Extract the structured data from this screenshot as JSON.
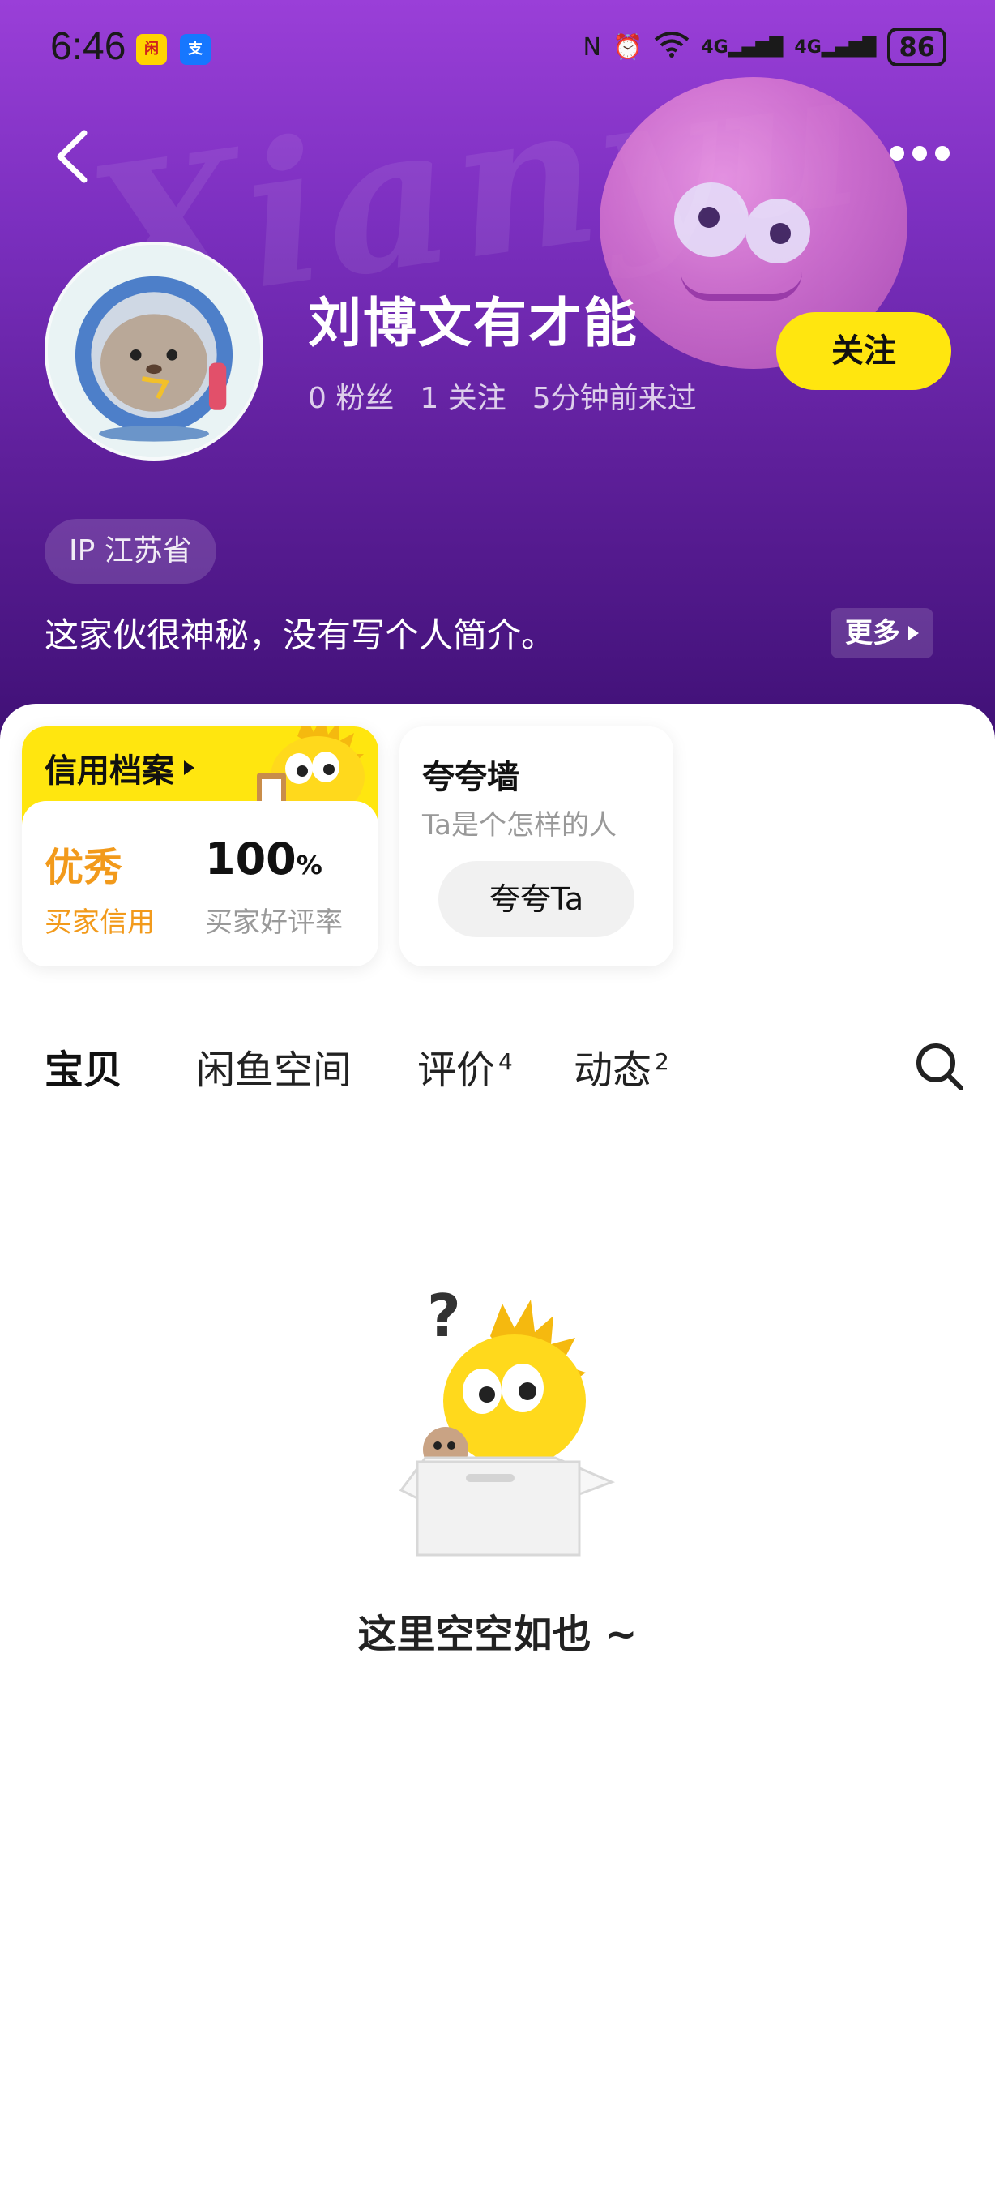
{
  "status_bar": {
    "time": "6:46",
    "net1": "4G",
    "net2": "4G",
    "battery": "86"
  },
  "profile": {
    "username": "刘博文有才能",
    "stats": [
      "0 粉丝",
      "1 关注",
      "5分钟前来过"
    ],
    "follow_label": "关注",
    "ip": "IP 江苏省",
    "bio": "这家伙很神秘，没有写个人简介。",
    "bio_more": "更多",
    "wordmark": "Xianyu"
  },
  "credit": {
    "title": "信用档案",
    "level": "优秀",
    "level_label": "买家信用",
    "rate_value": "100",
    "rate_unit": "%",
    "rate_label": "买家好评率"
  },
  "praise": {
    "title": "夸夸墙",
    "subtitle": "Ta是个怎样的人",
    "button": "夸夸Ta"
  },
  "tabs": [
    {
      "label": "宝贝",
      "badge": ""
    },
    {
      "label": "闲鱼空间",
      "badge": ""
    },
    {
      "label": "评价",
      "badge": "4"
    },
    {
      "label": "动态",
      "badge": "2"
    }
  ],
  "empty": {
    "message": "这里空空如也 ~"
  },
  "colors": {
    "accent": "#ffe60f",
    "credit_orange": "#f29a1b",
    "header_purple": "#6a27a8"
  }
}
